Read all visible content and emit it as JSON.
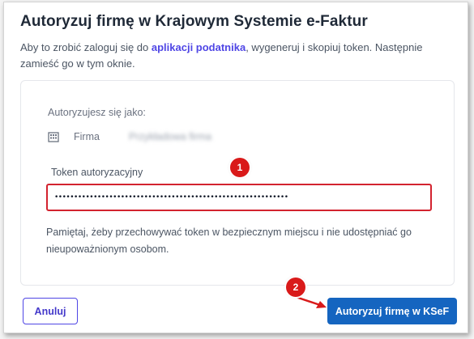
{
  "dialog": {
    "title": "Autoryzuj firmę w Krajowym Systemie e-Faktur",
    "intro_before": "Aby to zrobić zaloguj się do ",
    "intro_link": "aplikacji podatnika",
    "intro_after": ", wygeneruj i skopiuj token. Następnie zamieść go w tym oknie."
  },
  "card": {
    "authorizing_as_label": "Autoryzujesz się jako:",
    "firm_label": "Firma",
    "firm_icon": "building-icon",
    "firm_name": "Przykładowa firma",
    "token_label": "Token autoryzacyjny",
    "token_value": "••••••••••••••••••••••••••••••••••••••••••••••••••••••••••••",
    "hint": "Pamiętaj, żeby przechowywać token w bezpiecznym miejscu i nie udostępniać go nieupoważnionym osobom."
  },
  "annotations": {
    "badge_1": "1",
    "badge_2": "2",
    "color": "#d91a1a"
  },
  "footer": {
    "cancel_label": "Anuluj",
    "submit_label": "Autoryzuj firmę w KSeF"
  },
  "colors": {
    "accent": "#4f46e5",
    "primary_button": "#1565c0",
    "error_border": "#d3232f"
  }
}
